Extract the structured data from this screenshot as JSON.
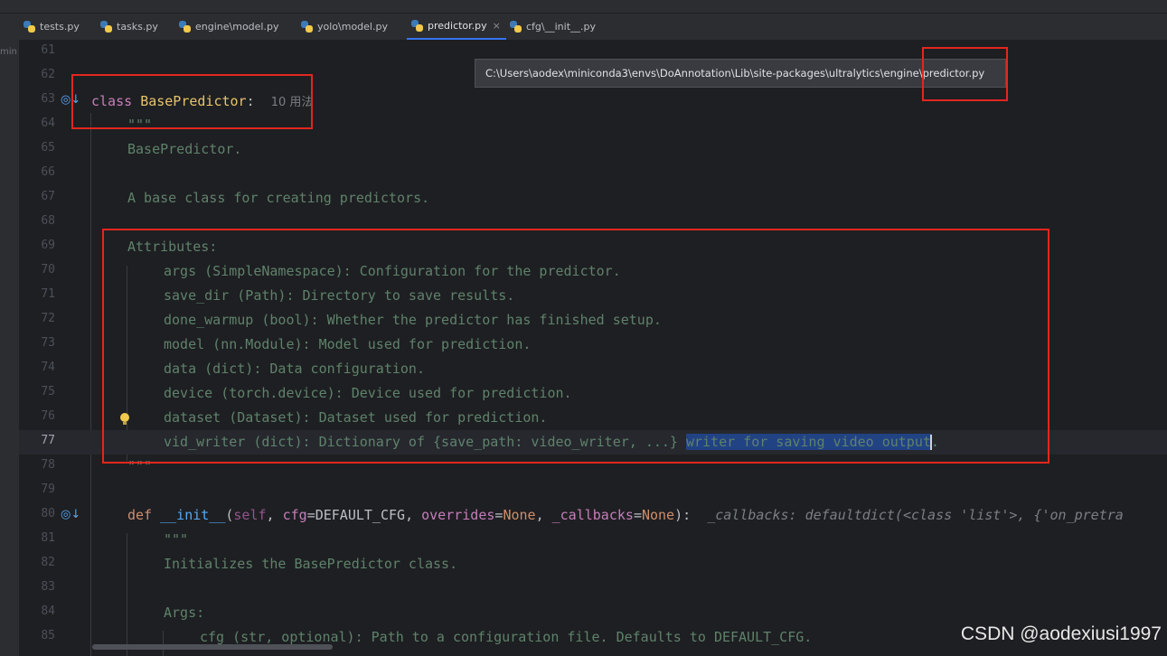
{
  "tabs": [
    {
      "label": "tests.py",
      "icon": "python-file-icon"
    },
    {
      "label": "tasks.py",
      "icon": "python-file-icon"
    },
    {
      "label": "engine\\model.py",
      "icon": "python-file-icon"
    },
    {
      "label": "yolo\\model.py",
      "icon": "python-file-icon"
    },
    {
      "label": "predictor.py",
      "icon": "python-file-icon",
      "active": true,
      "close": "×"
    },
    {
      "label": "cfg\\__init__.py",
      "icon": "python-file-icon"
    }
  ],
  "left_strip_label": "min",
  "tooltip": {
    "path": "C:\\Users\\aodex\\miniconda3\\envs\\DoAnnotation\\Lib\\site-packages\\ultralytics\\engine\\predictor.py"
  },
  "editor": {
    "current_line": 77,
    "lines": [
      {
        "n": "61"
      },
      {
        "n": "62"
      },
      {
        "n": "63",
        "kw": "class",
        "name": "BasePredictor",
        "colon": ":",
        "usages": "10 用法"
      },
      {
        "n": "64",
        "text": "\"\"\""
      },
      {
        "n": "65",
        "text": "BasePredictor."
      },
      {
        "n": "66"
      },
      {
        "n": "67",
        "text": "A base class for creating predictors."
      },
      {
        "n": "68"
      },
      {
        "n": "69",
        "text": "Attributes:"
      },
      {
        "n": "70",
        "text": "args (SimpleNamespace): Configuration for the predictor."
      },
      {
        "n": "71",
        "text": "save_dir (Path): Directory to save results."
      },
      {
        "n": "72",
        "text": "done_warmup (bool): Whether the predictor has finished setup."
      },
      {
        "n": "73",
        "text": "model (nn.Module): Model used for prediction."
      },
      {
        "n": "74",
        "text": "data (dict): Data configuration."
      },
      {
        "n": "75",
        "text": "device (torch.device): Device used for prediction."
      },
      {
        "n": "76",
        "text": "dataset (Dataset): Dataset used for prediction."
      },
      {
        "n": "77",
        "text": "vid_writer (dict): Dictionary of {save_path: video_writer, ...} ",
        "selected": "writer for saving video output",
        "tail": "."
      },
      {
        "n": "78",
        "text": "\"\"\""
      },
      {
        "n": "79"
      },
      {
        "n": "80",
        "kw": "def",
        "name": "__init__",
        "self": "self",
        "p1": "cfg",
        "v1": "DEFAULT_CFG",
        "p2": "overrides",
        "v2": "None",
        "p3": "_callbacks",
        "v3": "None",
        "end": "):",
        "hint": "_callbacks: defaultdict(<class 'list'>, {'on_pretra"
      },
      {
        "n": "81",
        "text": "\"\"\""
      },
      {
        "n": "82",
        "text": "Initializes the BasePredictor class."
      },
      {
        "n": "83"
      },
      {
        "n": "84",
        "text": "Args:"
      },
      {
        "n": "85",
        "text": "cfg (str, optional): Path to a configuration file. Defaults to DEFAULT_CFG."
      }
    ]
  },
  "watermark": "CSDN @aodexiusi1997",
  "colors": {
    "accent": "#3574f0",
    "highlight_box": "#e3261f",
    "docstring": "#5f826b",
    "keyword": "#cf8e6d",
    "class_name": "#e8c46a"
  }
}
